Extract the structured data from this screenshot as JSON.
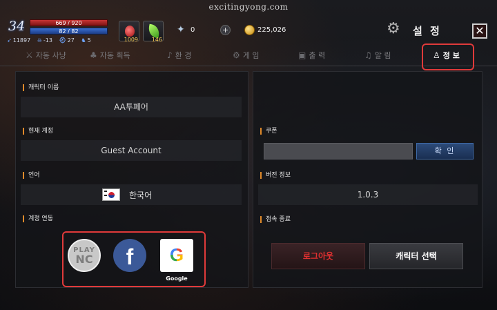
{
  "watermark": "excitingyong.com",
  "hud": {
    "level": "34",
    "hp": "669 / 920",
    "mp": "82 / 82",
    "stats": [
      "11897",
      "-13",
      "27",
      "5"
    ],
    "potion_count": "1009",
    "leaf_count": "146",
    "feather_count": "0",
    "gold": "225,026",
    "title": "설 정",
    "icons": [
      "potion-icon",
      "leaf-icon",
      "feather-icon",
      "plus-icon",
      "coin-icon",
      "gear-icon",
      "close-icon"
    ]
  },
  "tabs": [
    {
      "label": "자동 사냥",
      "icon": "sword-icon",
      "active": false
    },
    {
      "label": "자동 획득",
      "icon": "bag-icon",
      "active": false
    },
    {
      "label": "환 경",
      "icon": "music-icon",
      "active": false
    },
    {
      "label": "게 임",
      "icon": "gear-icon",
      "active": false
    },
    {
      "label": "출 력",
      "icon": "cube-icon",
      "active": false
    },
    {
      "label": "알 림",
      "icon": "bell-icon",
      "active": false
    },
    {
      "label": "정 보",
      "icon": "user-icon",
      "active": true
    }
  ],
  "left": {
    "char_name_label": "캐릭터 이름",
    "char_name": "AA투페어",
    "account_label": "현재 계정",
    "account": "Guest Account",
    "language_label": "언어",
    "language": "한국어",
    "link_label": "계정 연동",
    "link_buttons": {
      "plaync_top": "PLAY",
      "plaync_bottom": "NC",
      "facebook": "f",
      "google_glyph": "G",
      "google_label": "Google"
    }
  },
  "right": {
    "coupon_label": "쿠폰",
    "confirm": "확 인",
    "version_label": "버전 정보",
    "version": "1.0.3",
    "quit_label": "접속 종료",
    "logout": "로그아웃",
    "character_select": "캐릭터 선택"
  },
  "colors": {
    "accent_red": "#e03a3a",
    "label_bar": "#e08a2a",
    "confirm_blue": "#2c4a78"
  }
}
